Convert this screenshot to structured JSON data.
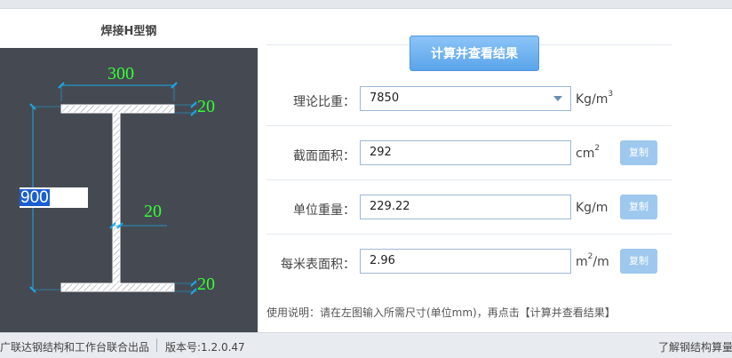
{
  "left_panel": {
    "title": "焊接H型钢",
    "drawing": {
      "width_label": "300",
      "top_flange_label": "20",
      "web_label": "20",
      "bottom_flange_label": "20",
      "height_value": "900",
      "colors": {
        "background": "#454a52",
        "dimension_text": "#33ff33",
        "dimension_line": "#19a9e6"
      }
    }
  },
  "calc_button_label": "计算并查看结果",
  "rows": [
    {
      "label": "理论比重：",
      "value": "7850",
      "unit_base": "Kg/m",
      "unit_sup": "3",
      "type": "select"
    },
    {
      "label": "截面面积：",
      "value": "292",
      "unit_base": "cm",
      "unit_sup": "2",
      "copy_label": "复制"
    },
    {
      "label": "单位重量：",
      "value": "229.22",
      "unit_base": "Kg/m",
      "unit_sup": "",
      "copy_label": "复制"
    },
    {
      "label": "每米表面积：",
      "value": "2.96",
      "unit_base": "m",
      "unit_sup": "2",
      "unit_tail": "/m",
      "copy_label": "复制"
    }
  ],
  "help_text": "使用说明：请在左图输入所需尺寸(单位mm)，再点击【计算并查看结果】",
  "footer": {
    "left_text": "广联达钢结构和工作台联合出品",
    "version": "版本号:1.2.0.47",
    "right_link": "了解钢结构算量"
  },
  "colors": {
    "button_blue": "#5aa4ea",
    "copy_button": "#9ec8ee",
    "field_border": "#9db8d6"
  }
}
